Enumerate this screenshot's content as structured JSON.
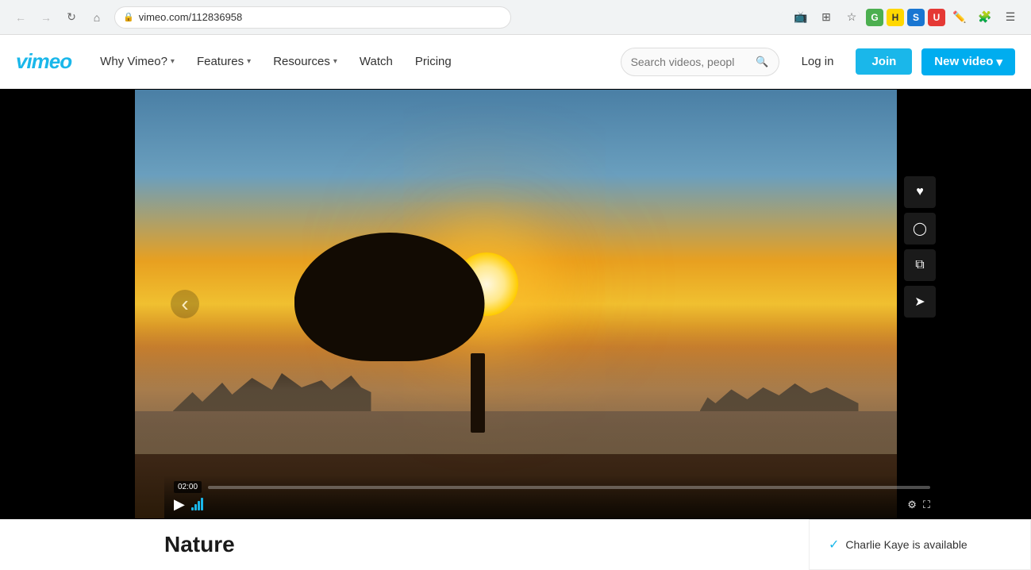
{
  "browser": {
    "url": "vimeo.com/112836958",
    "nav": {
      "back_disabled": true,
      "forward_disabled": true
    },
    "extensions": [
      "📺",
      "⊞",
      "⭐",
      "🟢",
      "🟡",
      "🔵",
      "🟣",
      "✏️",
      "📌",
      "≡"
    ]
  },
  "header": {
    "logo": "vimeo",
    "nav_items": [
      {
        "label": "Why Vimeo?",
        "has_dropdown": true
      },
      {
        "label": "Features",
        "has_dropdown": true
      },
      {
        "label": "Resources",
        "has_dropdown": true
      },
      {
        "label": "Watch",
        "has_dropdown": false
      },
      {
        "label": "Pricing",
        "has_dropdown": false
      }
    ],
    "search_placeholder": "Search videos, peopl",
    "login_label": "Log in",
    "join_label": "Join",
    "new_video_label": "New video"
  },
  "video": {
    "title": "Nature",
    "timestamp": "02:00",
    "progress_percent": 0
  },
  "side_actions": [
    {
      "icon": "♥",
      "label": "like-button"
    },
    {
      "icon": "🕐",
      "label": "watch-later-button"
    },
    {
      "icon": "⊞",
      "label": "collections-button"
    },
    {
      "icon": "✈",
      "label": "share-button"
    }
  ],
  "controls": {
    "play_icon": "▶",
    "volume_bars": [
      4,
      8,
      12,
      16
    ],
    "settings_icon": "⚙",
    "fullscreen_icon": "⛶"
  },
  "availability": {
    "check_icon": "✓",
    "text": "Charlie Kaye is available"
  }
}
